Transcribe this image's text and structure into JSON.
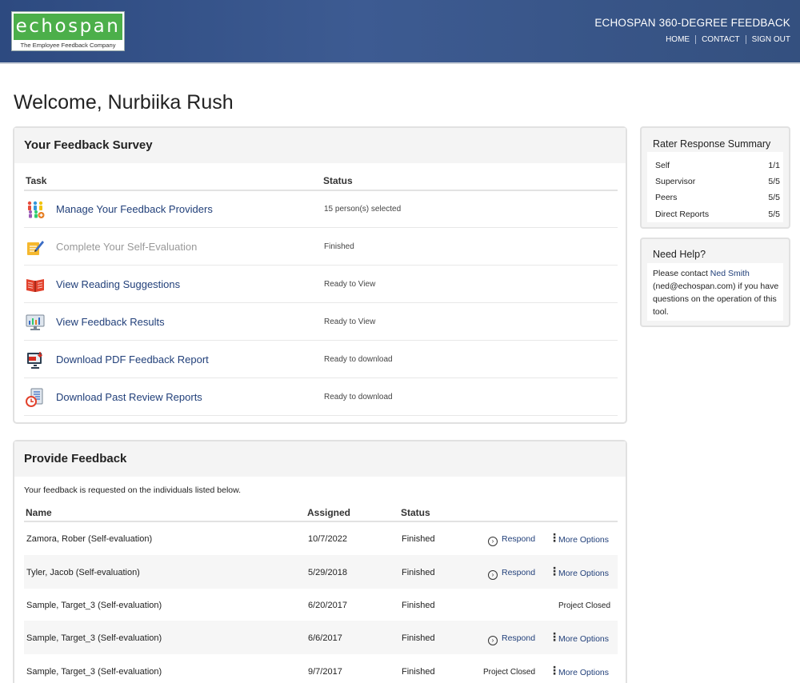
{
  "header": {
    "logo_text": "echospan",
    "logo_tagline": "The Employee Feedback Company",
    "product_title": "ECHOSPAN 360-DEGREE FEEDBACK",
    "nav": [
      "HOME",
      "CONTACT",
      "SIGN OUT"
    ]
  },
  "welcome": "Welcome, Nurbiika Rush",
  "survey": {
    "title": "Your Feedback Survey",
    "col_task": "Task",
    "col_status": "Status",
    "tasks": [
      {
        "label": "Manage Your Feedback Providers",
        "status": "15 person(s) selected",
        "icon": "people-group-icon",
        "enabled": true
      },
      {
        "label": "Complete Your Self-Evaluation",
        "status": "Finished",
        "icon": "pencil-document-icon",
        "enabled": false
      },
      {
        "label": "View Reading Suggestions",
        "status": "Ready to View",
        "icon": "open-book-icon",
        "enabled": true
      },
      {
        "label": "View Feedback Results",
        "status": "Ready to View",
        "icon": "monitor-chart-icon",
        "enabled": true
      },
      {
        "label": "Download PDF Feedback Report",
        "status": "Ready to download",
        "icon": "pdf-download-icon",
        "enabled": true
      },
      {
        "label": "Download Past Review Reports",
        "status": "Ready to download",
        "icon": "clock-document-icon",
        "enabled": true
      }
    ]
  },
  "provide": {
    "title": "Provide Feedback",
    "intro": "Your feedback is requested on the individuals listed below.",
    "col_name": "Name",
    "col_assigned": "Assigned",
    "col_status": "Status",
    "respond_label": "Respond",
    "more_label": "More Options",
    "closed_label": "Project Closed",
    "rows": [
      {
        "name": "Zamora, Rober (Self-evaluation)",
        "assigned": "10/7/2022",
        "status": "Finished"
      },
      {
        "name": "Tyler, Jacob (Self-evaluation)",
        "assigned": "5/29/2018",
        "status": "Finished"
      },
      {
        "name": "Sample, Target_3 (Self-evaluation)",
        "assigned": "6/20/2017",
        "status": "Finished"
      },
      {
        "name": "Sample, Target_3 (Self-evaluation)",
        "assigned": "6/6/2017",
        "status": "Finished"
      },
      {
        "name": "Sample, Target_3 (Self-evaluation)",
        "assigned": "9/7/2017",
        "status": "Finished"
      }
    ]
  },
  "summary": {
    "title": "Rater Response Summary",
    "rows": [
      {
        "label": "Self",
        "value": "1/1"
      },
      {
        "label": "Supervisor",
        "value": "5/5"
      },
      {
        "label": "Peers",
        "value": "5/5"
      },
      {
        "label": "Direct Reports",
        "value": "5/5"
      }
    ]
  },
  "help": {
    "title": "Need Help?",
    "text_before": "Please contact ",
    "contact_name": "Ned Smith",
    "text_after": " (ned@echospan.com) if you have questions on the operation of this tool."
  }
}
